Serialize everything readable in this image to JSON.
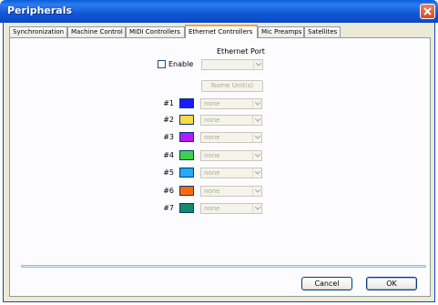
{
  "window": {
    "title": "Peripherals"
  },
  "tabs": [
    {
      "label": "Synchronization",
      "active": false
    },
    {
      "label": "Machine Control",
      "active": false
    },
    {
      "label": "MIDI Controllers",
      "active": false
    },
    {
      "label": "Ethernet Controllers",
      "active": true
    },
    {
      "label": "Mic Preamps",
      "active": false
    },
    {
      "label": "Satellites",
      "active": false
    }
  ],
  "ethernet": {
    "port_label": "Ethernet Port",
    "enable_label": "Enable",
    "enable_checked": false,
    "port_value": "",
    "name_unit_label": "Name Unit(s)"
  },
  "units": [
    {
      "label": "#1",
      "color": "#1a1aff",
      "value": "none"
    },
    {
      "label": "#2",
      "color": "#ffd84a",
      "value": "none"
    },
    {
      "label": "#3",
      "color": "#b21aff",
      "value": "none"
    },
    {
      "label": "#4",
      "color": "#3fd14a",
      "value": "none"
    },
    {
      "label": "#5",
      "color": "#2aa8f2",
      "value": "none"
    },
    {
      "label": "#6",
      "color": "#ff6a10",
      "value": "none"
    },
    {
      "label": "#7",
      "color": "#138a6b",
      "value": "none"
    }
  ],
  "footer": {
    "cancel_label": "Cancel",
    "ok_label": "OK"
  }
}
